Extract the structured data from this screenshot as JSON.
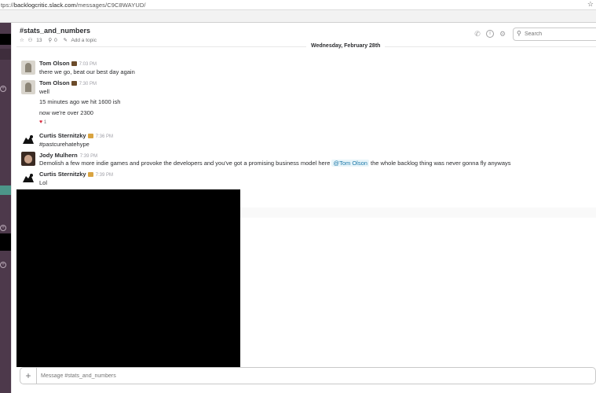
{
  "browser": {
    "url_prefix": "tps://",
    "url_host": "backlogcritic.slack.com",
    "url_path": "/messages/C9C8WAYUD/"
  },
  "channel": {
    "name": "#stats_and_numbers",
    "member_count": "13",
    "pinned_count": "0",
    "topic_placeholder": "Add a topic",
    "search_placeholder": "Search"
  },
  "date_separator": "Wednesday, February 28th",
  "messages": [
    {
      "sender": "Tom Olson",
      "time": "7:03 PM",
      "lines": [
        "there we go, beat our best day again"
      ]
    },
    {
      "sender": "Tom Olson",
      "time": "7:30 PM",
      "lines": [
        "well",
        "15 minutes ago we hit 1600 ish",
        "now we're over 2300"
      ],
      "reaction_count": "1"
    },
    {
      "sender": "Curtis Sternitzky",
      "time": "7:36 PM",
      "lines": [
        "#pastcurehatehype"
      ]
    },
    {
      "sender": "Jody Mulhern",
      "time": "7:39 PM",
      "text_before": "Demolish a few more indie games and provoke the developers and you've got a promising business model here",
      "mention": "@Tom Olson",
      "text_after": "the whole backlog thing was never gonna fly anyways"
    },
    {
      "sender": "Curtis Sternitzky",
      "time": "7:39 PM",
      "lines": [
        "Lol"
      ]
    }
  ],
  "composer": {
    "placeholder": "Message #stats_and_numbers"
  },
  "colors": {
    "sidebar": "#4d394b",
    "sidebar_active": "#4c9689",
    "mention_text": "#1d78a8",
    "heart": "#d72b3f"
  },
  "icons": [
    "star-icon",
    "people-icon",
    "pin-icon",
    "pencil-icon",
    "phone-icon",
    "info-icon",
    "gear-icon",
    "search-icon",
    "heart-icon",
    "plus-icon"
  ]
}
